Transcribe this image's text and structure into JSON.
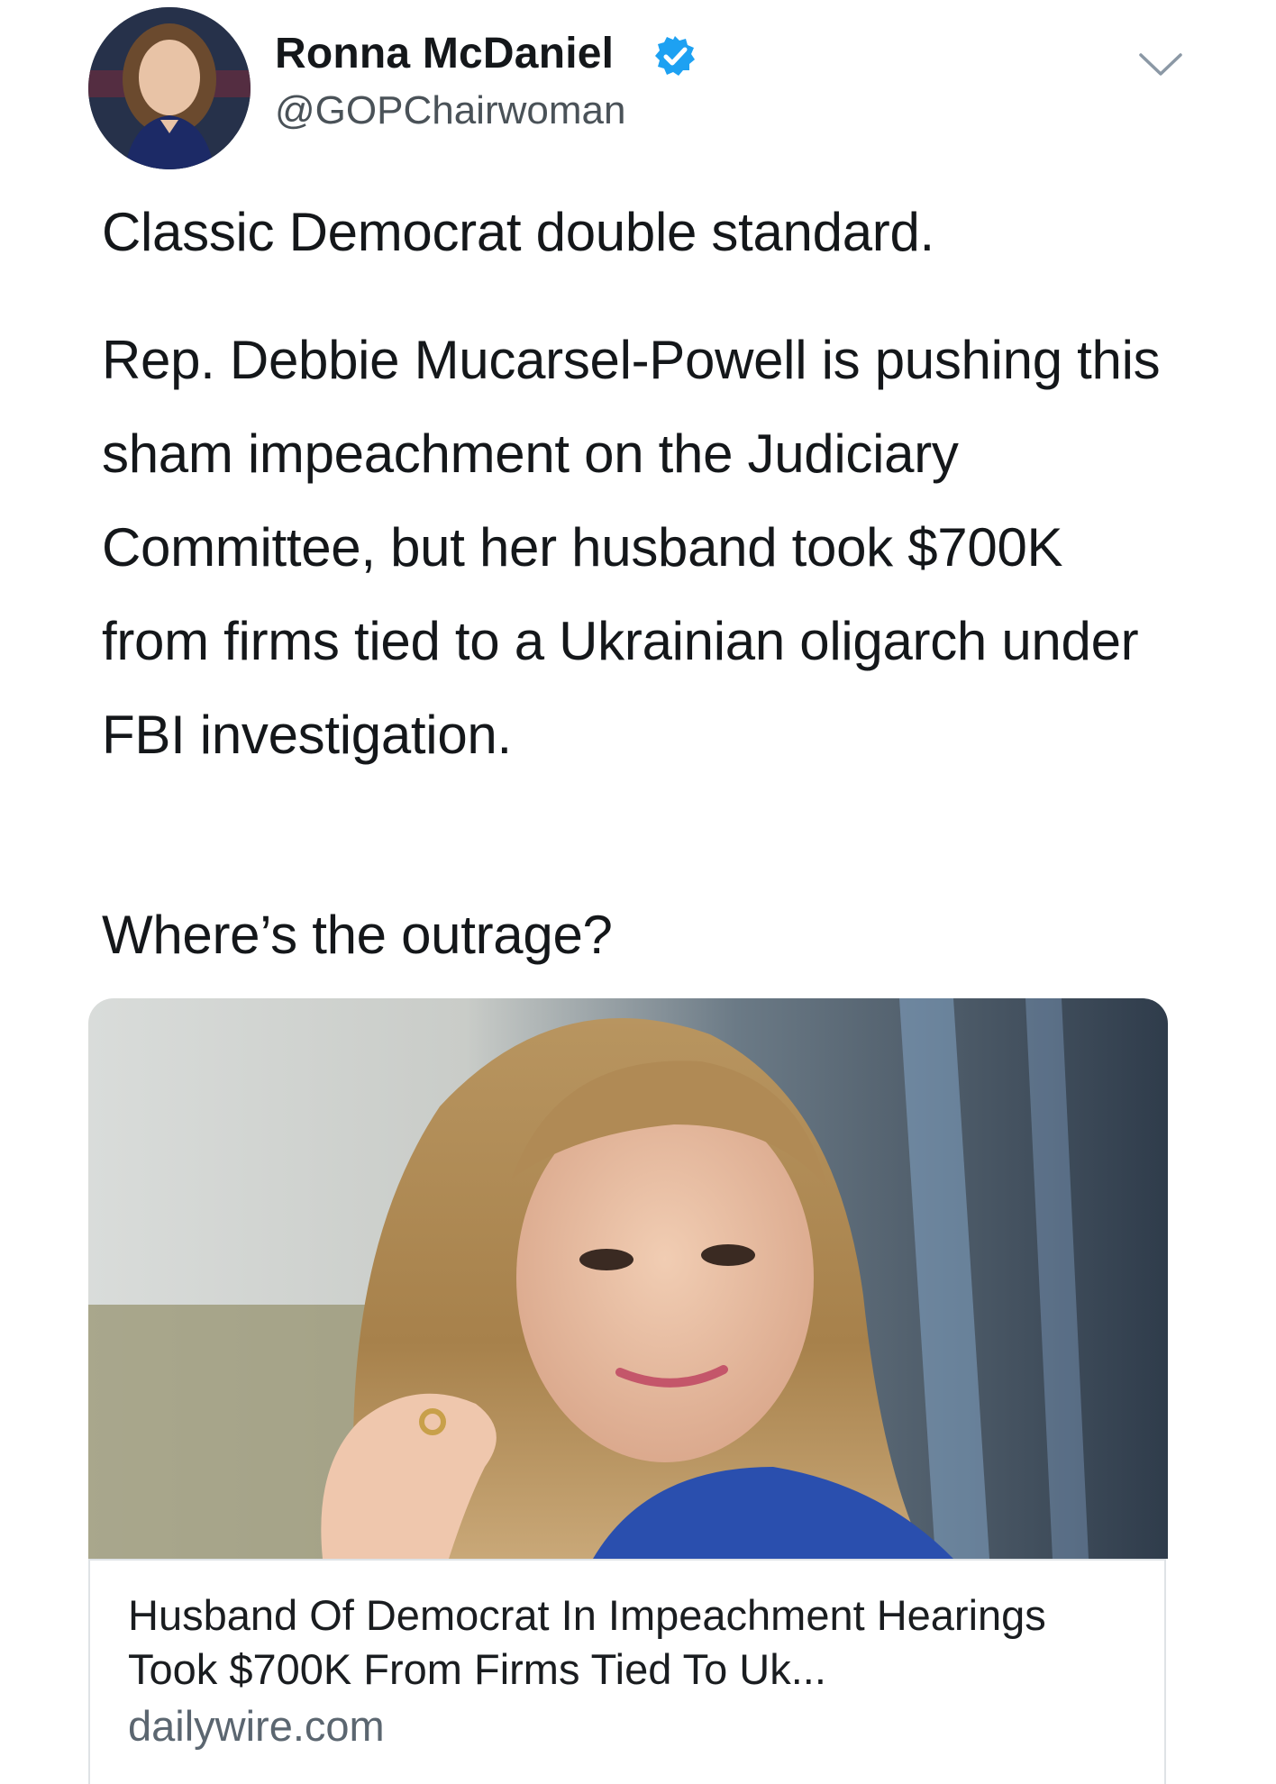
{
  "author": {
    "name": "Ronna McDaniel",
    "handle": "@GOPChairwoman",
    "verified": true,
    "accent_color": "#1da1f2"
  },
  "icons": {
    "verified": "verified-badge-icon",
    "more": "chevron-down-icon"
  },
  "tweet": {
    "paragraph_1": "Classic Democrat double standard.",
    "paragraph_2": "Rep. Debbie Mucarsel-Powell is pushing this sham impeachment on the Judiciary Committee, but her husband took $700K from firms tied to a Ukrainian oligarch under FBI investigation.",
    "paragraph_3": "Where’s the outrage?"
  },
  "card": {
    "title": "Husband Of Democrat In Impeachment Hearings Took $700K From Firms Tied To Uk...",
    "domain": "dailywire.com"
  }
}
